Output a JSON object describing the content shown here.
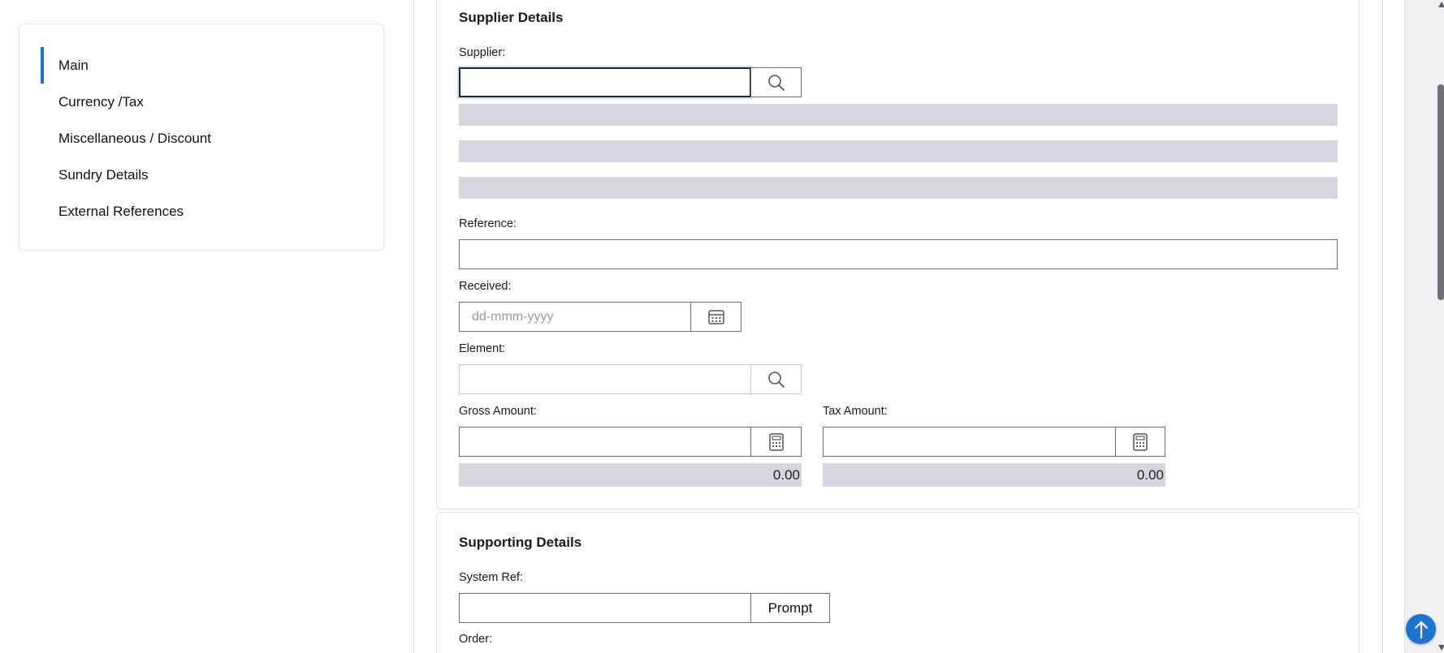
{
  "nav": {
    "items": [
      {
        "label": "Main",
        "active": true
      },
      {
        "label": "Currency /Tax"
      },
      {
        "label": "Miscellaneous / Discount"
      },
      {
        "label": "Sundry Details"
      },
      {
        "label": "External References"
      }
    ]
  },
  "supplier_section": {
    "title": "Supplier Details",
    "supplier_label": "Supplier:",
    "supplier_value": "",
    "reference_label": "Reference:",
    "reference_value": "",
    "received_label": "Received:",
    "received_placeholder": "dd-mmm-yyyy",
    "element_label": "Element:",
    "element_value": "",
    "gross_label": "Gross Amount:",
    "gross_value": "",
    "gross_total": "0.00",
    "tax_label": "Tax Amount:",
    "tax_value": "",
    "tax_total": "0.00"
  },
  "supporting_section": {
    "title": "Supporting Details",
    "system_ref_label": "System Ref:",
    "system_ref_value": "",
    "prompt_label": "Prompt",
    "order_label": "Order:"
  },
  "icons": {
    "search": "search-icon",
    "calendar": "calendar-icon",
    "calculator": "calculator-icon",
    "arrow_up": "arrow-up-icon"
  },
  "colors": {
    "accent": "#1b75d0",
    "readonly_bg": "#d6d6e0"
  }
}
